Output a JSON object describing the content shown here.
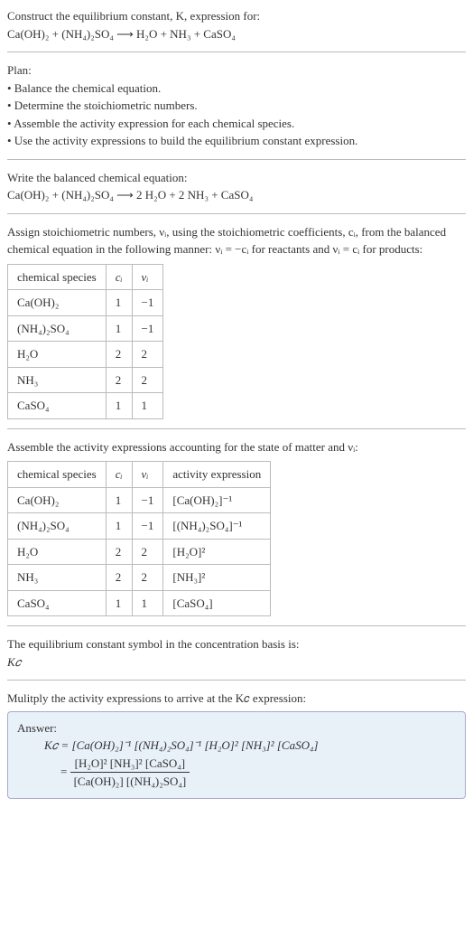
{
  "intro": {
    "line1": "Construct the equilibrium constant, K, expression for:",
    "equation": "Ca(OH)₂ + (NH₄)₂SO₄  ⟶  H₂O + NH₃ + CaSO₄"
  },
  "plan": {
    "title": "Plan:",
    "b1": "• Balance the chemical equation.",
    "b2": "• Determine the stoichiometric numbers.",
    "b3": "• Assemble the activity expression for each chemical species.",
    "b4": "• Use the activity expressions to build the equilibrium constant expression."
  },
  "balanced": {
    "title": "Write the balanced chemical equation:",
    "equation": "Ca(OH)₂ + (NH₄)₂SO₄  ⟶  2 H₂O + 2 NH₃ + CaSO₄"
  },
  "assign": {
    "part1": "Assign stoichiometric numbers, νᵢ, using the stoichiometric coefficients, cᵢ, from the balanced chemical equation in the following manner: νᵢ = −cᵢ for reactants and νᵢ = cᵢ for products:"
  },
  "table1": {
    "h1": "chemical species",
    "h2": "cᵢ",
    "h3": "νᵢ",
    "rows": [
      {
        "sp": "Ca(OH)₂",
        "c": "1",
        "v": "−1"
      },
      {
        "sp": "(NH₄)₂SO₄",
        "c": "1",
        "v": "−1"
      },
      {
        "sp": "H₂O",
        "c": "2",
        "v": "2"
      },
      {
        "sp": "NH₃",
        "c": "2",
        "v": "2"
      },
      {
        "sp": "CaSO₄",
        "c": "1",
        "v": "1"
      }
    ]
  },
  "assemble": "Assemble the activity expressions accounting for the state of matter and νᵢ:",
  "table2": {
    "h1": "chemical species",
    "h2": "cᵢ",
    "h3": "νᵢ",
    "h4": "activity expression",
    "rows": [
      {
        "sp": "Ca(OH)₂",
        "c": "1",
        "v": "−1",
        "a": "[Ca(OH)₂]⁻¹"
      },
      {
        "sp": "(NH₄)₂SO₄",
        "c": "1",
        "v": "−1",
        "a": "[(NH₄)₂SO₄]⁻¹"
      },
      {
        "sp": "H₂O",
        "c": "2",
        "v": "2",
        "a": "[H₂O]²"
      },
      {
        "sp": "NH₃",
        "c": "2",
        "v": "2",
        "a": "[NH₃]²"
      },
      {
        "sp": "CaSO₄",
        "c": "1",
        "v": "1",
        "a": "[CaSO₄]"
      }
    ]
  },
  "symbol": {
    "line1": "The equilibrium constant symbol in the concentration basis is:",
    "line2": "K𝑐"
  },
  "multiply": "Mulitply the activity expressions to arrive at the K𝑐 expression:",
  "answer": {
    "label": "Answer:",
    "eq1": "K𝑐 = [Ca(OH)₂]⁻¹ [(NH₄)₂SO₄]⁻¹ [H₂O]² [NH₃]² [CaSO₄]",
    "eq2_prefix": "= ",
    "eq2_num": "[H₂O]² [NH₃]² [CaSO₄]",
    "eq2_den": "[Ca(OH)₂] [(NH₄)₂SO₄]"
  }
}
